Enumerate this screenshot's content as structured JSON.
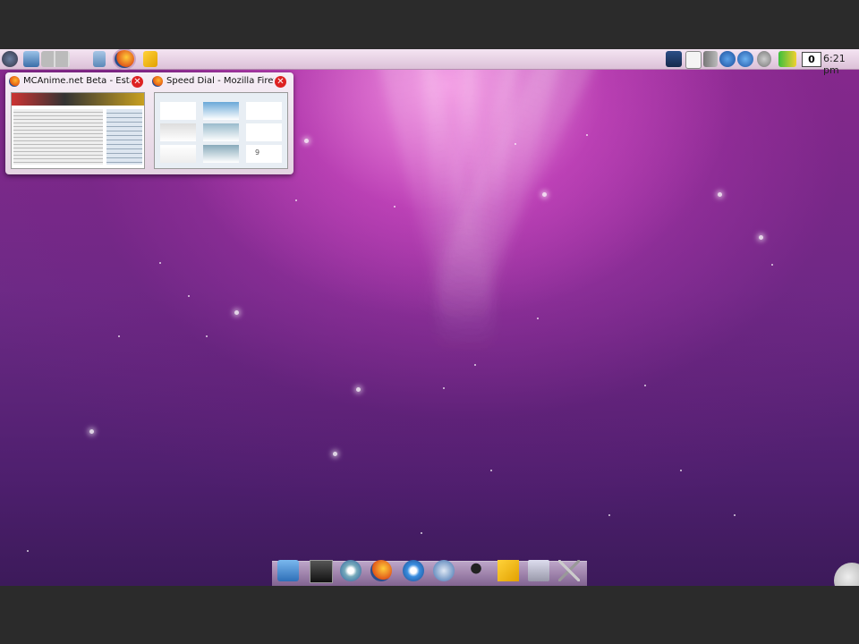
{
  "panel": {
    "clock_counter": "0",
    "clock_time": "6:21 pm"
  },
  "previews": [
    {
      "title": "MCAnime.net Beta - Esta ve",
      "close": "✕"
    },
    {
      "title": "Speed Dial - Mozilla Firefo:",
      "close": "✕"
    }
  ],
  "speed_dial_badge": "9",
  "colors": {
    "panel_bg": "#e8d3e4",
    "close_red": "#dd2222",
    "wallpaper_main": "#6d2a86"
  },
  "icons": {
    "panel_left": [
      "kde-menu-icon",
      "desktop-icon",
      "pager-icon",
      "window-list-icon",
      "firefox-icon",
      "sticky-note-icon"
    ],
    "tray": [
      "display-icon",
      "clipboard-icon",
      "volume-icon",
      "network-icon",
      "update-icon",
      "info-icon",
      "battery-icon"
    ],
    "dock": [
      "home-folder-icon",
      "terminal-icon",
      "media-player-icon",
      "firefox-icon",
      "chat-icon",
      "bird-icon",
      "inkscape-icon",
      "notes-icon",
      "trash-icon",
      "settings-icon"
    ]
  }
}
